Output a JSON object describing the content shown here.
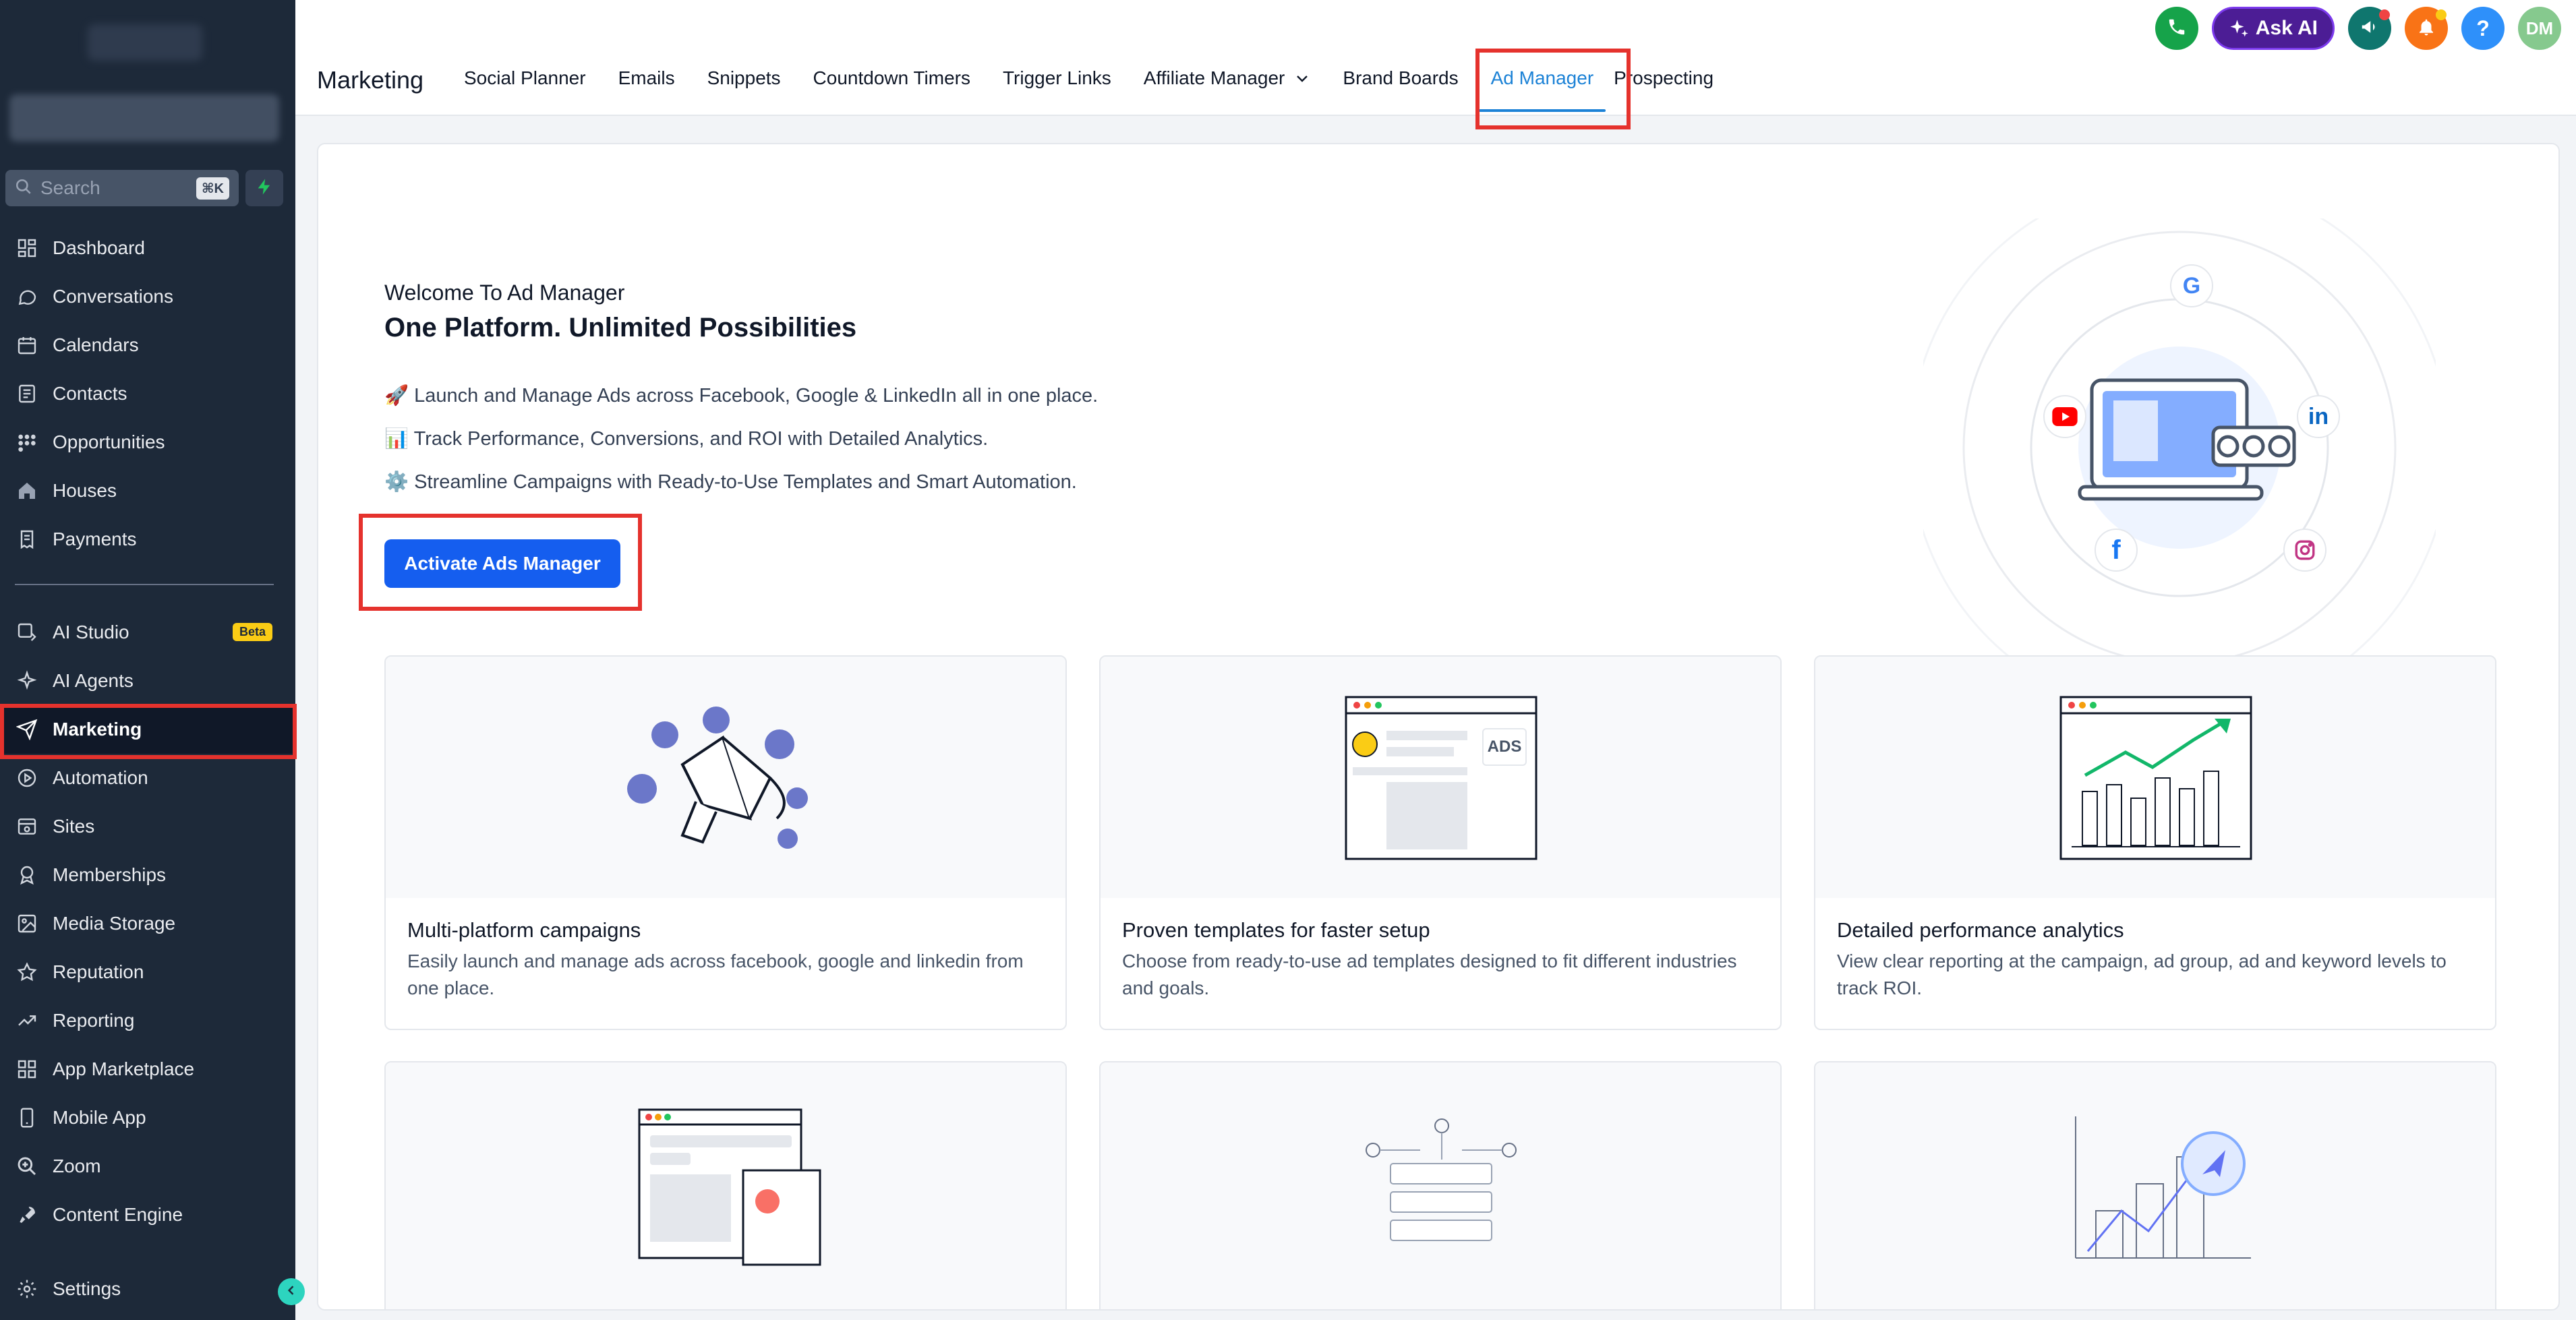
{
  "sidebar": {
    "search_placeholder": "Search",
    "search_shortcut": "⌘K",
    "items": [
      {
        "label": "Dashboard",
        "icon": "dashboard-icon"
      },
      {
        "label": "Conversations",
        "icon": "chat-icon"
      },
      {
        "label": "Calendars",
        "icon": "calendar-icon"
      },
      {
        "label": "Contacts",
        "icon": "contacts-icon"
      },
      {
        "label": "Opportunities",
        "icon": "opportunities-icon"
      },
      {
        "label": "Houses",
        "icon": "house-icon"
      },
      {
        "label": "Payments",
        "icon": "payments-icon"
      },
      {
        "label": "AI Studio",
        "icon": "ai-studio-icon",
        "badge": "Beta"
      },
      {
        "label": "AI Agents",
        "icon": "sparkle-icon"
      },
      {
        "label": "Marketing",
        "icon": "send-icon"
      },
      {
        "label": "Automation",
        "icon": "automation-icon"
      },
      {
        "label": "Sites",
        "icon": "sites-icon"
      },
      {
        "label": "Memberships",
        "icon": "membership-icon"
      },
      {
        "label": "Media Storage",
        "icon": "image-icon"
      },
      {
        "label": "Reputation",
        "icon": "star-icon"
      },
      {
        "label": "Reporting",
        "icon": "trend-icon"
      },
      {
        "label": "App Marketplace",
        "icon": "grid-icon"
      },
      {
        "label": "Mobile App",
        "icon": "mobile-icon"
      },
      {
        "label": "Zoom",
        "icon": "zoom-icon"
      },
      {
        "label": "Content Engine",
        "icon": "rocket-icon"
      },
      {
        "label": "Settings",
        "icon": "gear-icon"
      }
    ]
  },
  "header": {
    "title": "Marketing",
    "tabs": [
      "Social Planner",
      "Emails",
      "Snippets",
      "Countdown Timers",
      "Trigger Links",
      "Affiliate Manager",
      "Brand Boards",
      "Ad Manager",
      "Prospecting"
    ],
    "ask_ai": "Ask AI",
    "avatar_initials": "DM",
    "help": "?"
  },
  "content": {
    "welcome": "Welcome To Ad Manager",
    "headline": "One Platform. Unlimited Possibilities",
    "features": [
      "🚀 Launch and Manage Ads across Facebook, Google & LinkedIn all in one place.",
      "📊 Track Performance, Conversions, and ROI with Detailed Analytics.",
      "⚙️ Streamline Campaigns with Ready-to-Use Templates and Smart Automation."
    ],
    "cta": "Activate Ads Manager",
    "ads_badge": "ADS",
    "cards": [
      {
        "title": "Multi-platform campaigns",
        "desc": "Easily launch and manage ads across facebook, google and linkedin from one place."
      },
      {
        "title": "Proven templates for faster setup",
        "desc": "Choose from ready-to-use ad templates designed to fit different industries and goals."
      },
      {
        "title": "Detailed performance analytics",
        "desc": "View clear reporting at the campaign, ad group, ad and keyword levels to track ROI."
      }
    ]
  },
  "colors": {
    "sidebar_bg": "#1d2939",
    "accent": "#155eef",
    "active_tab": "#1c82d6",
    "highlight": "#e5322d"
  }
}
